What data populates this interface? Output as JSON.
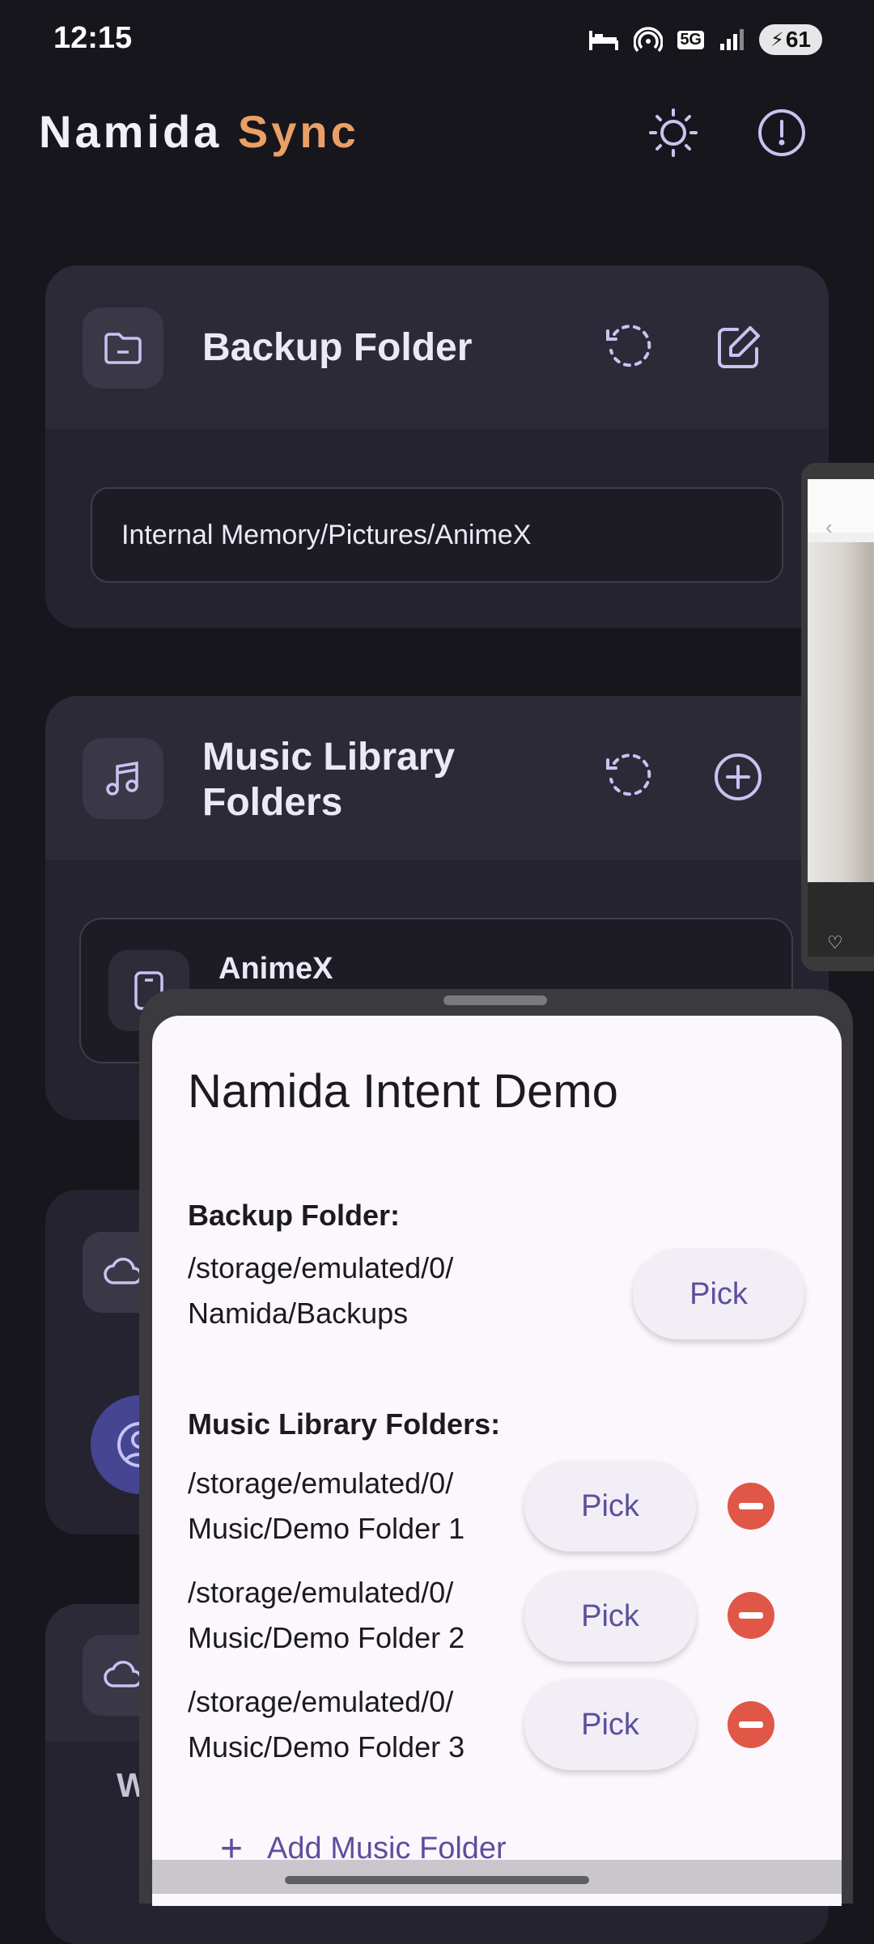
{
  "status": {
    "time": "12:15",
    "battery": "61",
    "network": "5G"
  },
  "header": {
    "title_main": "Namida",
    "title_accent": "Sync",
    "accent_color": "#e9a065"
  },
  "backup_card": {
    "title": "Backup Folder",
    "path": "Internal Memory/Pictures/AnimeX"
  },
  "music_card": {
    "title_line1": "Music Library",
    "title_line2": "Folders",
    "item_name": "AnimeX"
  },
  "bg_card_3": {
    "text": ""
  },
  "bg_card_4": {
    "partial_text": "W"
  },
  "sheet": {
    "title": "Namida Intent Demo",
    "backup_label": "Backup Folder:",
    "backup_path_1": "/storage/emulated/0/",
    "backup_path_2": "Namida/Backups",
    "pick_label": "Pick",
    "music_label": "Music Library Folders:",
    "folders": [
      {
        "line1": "/storage/emulated/0/",
        "line2": "Music/Demo Folder 1"
      },
      {
        "line1": "/storage/emulated/0/",
        "line2": "Music/Demo Folder 2"
      },
      {
        "line1": "/storage/emulated/0/",
        "line2": "Music/Demo Folder 3"
      }
    ],
    "add_label": "Add Music Folder"
  },
  "colors": {
    "card": "#25232f",
    "sheet_bg": "#fcf7fd",
    "primary": "#5d4f9c",
    "danger": "#e05748"
  },
  "icons": {
    "theme": "sun-icon",
    "info": "alert-circle-icon",
    "folder": "folder-icon",
    "refresh": "refresh-icon",
    "edit": "edit-icon",
    "music": "music-note-icon",
    "add": "add-circle-icon",
    "cloud": "cloud-icon",
    "remove": "remove-circle-icon"
  }
}
